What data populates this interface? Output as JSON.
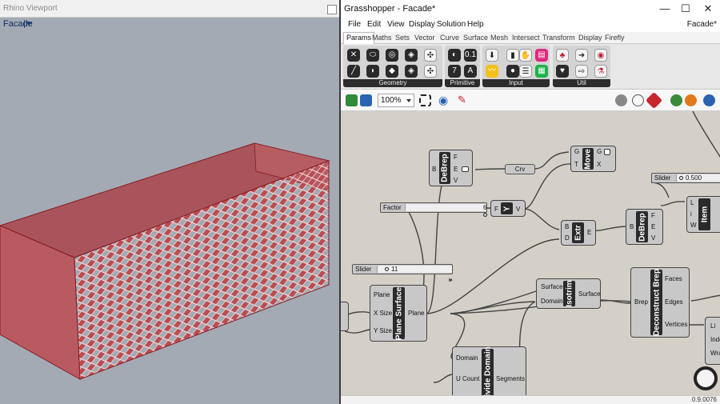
{
  "rhino": {
    "title": "Rhino Viewport",
    "viewport_name": "Facade"
  },
  "gh": {
    "title": "Grasshopper - Facade*",
    "doc_name": "Facade*",
    "window_buttons": [
      "—",
      "☐",
      "✕"
    ],
    "menus": [
      "File",
      "Edit",
      "View",
      "Display",
      "Solution",
      "Help"
    ],
    "tabs": [
      "Params",
      "Maths",
      "Sets",
      "Vector",
      "Curve",
      "Surface",
      "Mesh",
      "Intersect",
      "Transform",
      "Display",
      "Firefly"
    ],
    "active_tab": "Params",
    "panels": [
      "Geometry",
      "Primitive",
      "Input",
      "Util"
    ],
    "zoom": "100%",
    "status_version": "0.9.0076"
  },
  "canvas": {
    "debrep_top": {
      "title": "DeBrep",
      "inputs": [
        "B"
      ],
      "outputs": [
        "F",
        "E",
        "V"
      ]
    },
    "crv": {
      "label": "Crv"
    },
    "move": {
      "title": "Move",
      "inputs": [
        "G",
        "T"
      ],
      "outputs": [
        "G",
        "X"
      ]
    },
    "slider_500": {
      "label": "Slider",
      "value": "0.500"
    },
    "factor_slider": {
      "label": "Factor",
      "value": "6"
    },
    "y_comp": {
      "title": "Y",
      "inputs": [
        "F"
      ],
      "outputs": [
        "V"
      ]
    },
    "extr": {
      "title": "Extr",
      "inputs": [
        "B",
        "D"
      ],
      "outputs": [
        "E"
      ]
    },
    "debrep_right": {
      "title": "DeBrep",
      "inputs": [
        "B"
      ],
      "outputs": [
        "F",
        "E",
        "V"
      ]
    },
    "item": {
      "title": "Item",
      "inputs": [
        "L",
        "i",
        "W"
      ]
    },
    "slider_11": {
      "label": "Slider",
      "value": "11"
    },
    "plane_surface": {
      "title": "Plane Surface",
      "inputs": [
        "Plane",
        "X Size",
        "Y Size"
      ],
      "outputs": [
        "Plane"
      ]
    },
    "isotrim": {
      "title": "Isotrim",
      "inputs": [
        "Surface",
        "Domain"
      ],
      "outputs": [
        "Surface"
      ]
    },
    "deconstruct_brep": {
      "title": "Deconstruct Brep",
      "inputs": [
        "Brep"
      ],
      "outputs": [
        "Faces",
        "Edges",
        "Vertices"
      ]
    },
    "divide_domain": {
      "title": "Divide Domain",
      "inputs": [
        "Domain",
        "U Count"
      ],
      "outputs": [
        "Segments"
      ]
    },
    "list_item": {
      "inputs": [
        "Li",
        "Inde",
        "Wra"
      ]
    }
  }
}
